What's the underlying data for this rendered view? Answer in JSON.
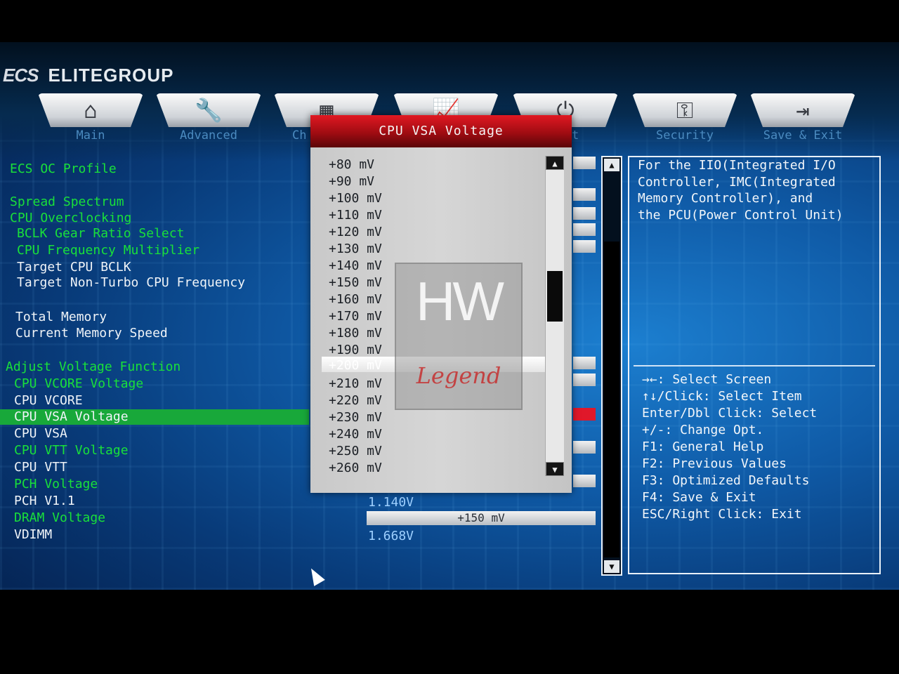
{
  "brand": {
    "logo": "ECS",
    "name": "ELITEGROUP"
  },
  "tabs": [
    {
      "label": "Main",
      "icon": "home-icon",
      "glyph": "⌂"
    },
    {
      "label": "Advanced",
      "icon": "wrench-icon",
      "glyph": "🔧"
    },
    {
      "label": "Ch",
      "icon": "chip-icon",
      "glyph": "▦"
    },
    {
      "label": "",
      "icon": "chart-icon",
      "glyph": "📈"
    },
    {
      "label": "t",
      "icon": "power-icon",
      "glyph": "⏻"
    },
    {
      "label": "Security",
      "icon": "key-icon",
      "glyph": "⚿"
    },
    {
      "label": "Save & Exit",
      "icon": "exit-icon",
      "glyph": "⇥"
    }
  ],
  "menu": [
    {
      "label": "ECS OC Profile"
    },
    {
      "label": "Spread Spectrum"
    },
    {
      "label": "CPU Overclocking"
    },
    {
      "label": "BCLK Gear Ratio Select"
    },
    {
      "label": "CPU Frequency Multiplier"
    },
    {
      "label": "Target CPU BCLK"
    },
    {
      "label": "Target Non-Turbo CPU Frequency"
    },
    {
      "label": "Total Memory"
    },
    {
      "label": "Current Memory Speed"
    },
    {
      "label": "Adjust Voltage Function"
    },
    {
      "label": "CPU VCORE Voltage"
    },
    {
      "label": "CPU VCORE"
    },
    {
      "label": "CPU VSA Voltage"
    },
    {
      "label": "CPU VSA"
    },
    {
      "label": "CPU VTT Voltage"
    },
    {
      "label": "CPU VTT"
    },
    {
      "label": "PCH Voltage"
    },
    {
      "label": "PCH V1.1"
    },
    {
      "label": "DRAM Voltage"
    },
    {
      "label": "VDIMM"
    }
  ],
  "values": {
    "pch_v11": "1.140V",
    "dram_voltage": "+150 mV",
    "vdimm": "1.668V"
  },
  "popup": {
    "title": "CPU VSA Voltage",
    "options": [
      "+80 mV",
      "+90 mV",
      "+100 mV",
      "+110 mV",
      "+120 mV",
      "+130 mV",
      "+140 mV",
      "+150 mV",
      "+160 mV",
      "+170 mV",
      "+180 mV",
      "+190 mV",
      "+200 mV",
      "+210 mV",
      "+220 mV",
      "+230 mV",
      "+240 mV",
      "+250 mV",
      "+260 mV"
    ],
    "selected": "+200 mV"
  },
  "help": {
    "description": "For the IIO(Integrated I/O\nController, IMC(Integrated\nMemory Controller), and\nthe PCU(Power Control Unit)",
    "keys": [
      "→←: Select Screen",
      "↑↓/Click: Select Item",
      "Enter/Dbl Click: Select",
      "+/-: Change Opt.",
      "F1: General Help",
      "F2: Previous Values",
      "F3: Optimized Defaults",
      "F4: Save & Exit",
      "ESC/Right Click: Exit"
    ]
  },
  "watermark": {
    "big": "HW",
    "small": "Legend"
  },
  "colors": {
    "accent_green": "#19e03a",
    "title_red": "#d0141e",
    "bg_blue": "#0f5aa6"
  }
}
